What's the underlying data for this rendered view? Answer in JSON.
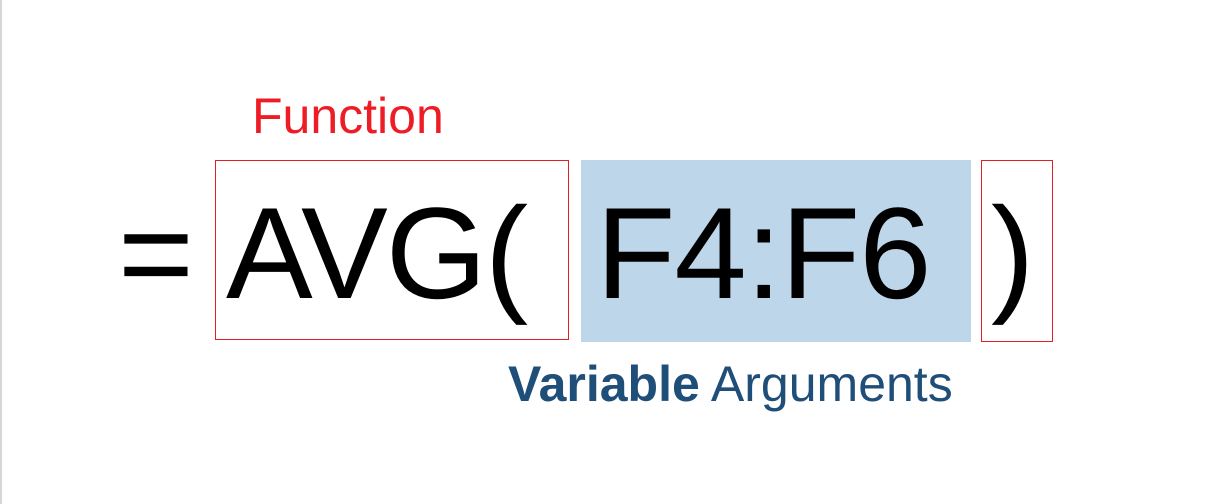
{
  "labels": {
    "function": "Function",
    "arguments_bold": "Variable",
    "arguments_rest": " Arguments"
  },
  "formula": {
    "equals": "=",
    "function_part": "AVG(",
    "arguments": "F4:F6",
    "closing": ")"
  },
  "colors": {
    "function_label": "#ee1c25",
    "box_border": "#e31f26",
    "arguments_highlight": "#bed6ea",
    "arguments_label": "#1f4e79",
    "formula_text": "#000000"
  }
}
